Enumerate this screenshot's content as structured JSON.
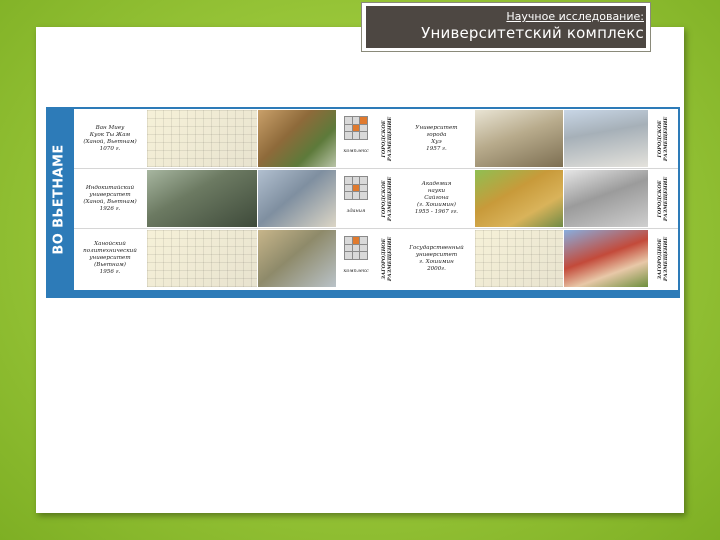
{
  "header": {
    "line1": "Научное исследование:",
    "line2": "Университетский комплекс"
  },
  "panel": {
    "vertical_label": "ВО ВЬЕТНАМЕ",
    "rows": [
      {
        "caption_left": "Ван Миеу\nКуок Ты Жам\n(Ханой, Вьетнам)\n1070 г.",
        "icon_caption_1": "комплекс",
        "rotated_1": "ГОРОДСКОЕ\nРАЗМЕЩЕНИЕ",
        "caption_right": "Университет\nгорода\nХуэ\n1957 г.",
        "icon_caption_2": "комплекс",
        "rotated_2": "ГОРОДСКОЕ\nРАЗМЕЩЕНИЕ"
      },
      {
        "caption_left": "Индокитайский\nуниверситет\n(Ханой, Вьетнам)\n1926 г.",
        "icon_caption_1": "здания",
        "rotated_1": "ГОРОДСКОЕ\nРАЗМЕЩЕНИЕ",
        "caption_right": "Академия\nнауки\nСайгона\n(г. Хошимин)\n1955 - 1967 гг.",
        "icon_caption_2": "здания",
        "rotated_2": "ГОРОДСКОЕ\nРАЗМЕЩЕНИЕ"
      },
      {
        "caption_left": "Ханойский\nполитехнический\nуниверситет\n(Вьетнам)\n1956 г.",
        "icon_caption_1": "комплекс",
        "rotated_1": "ЗАГОРОДНОЕ\nРАЗМЕЩЕНИЕ",
        "caption_right": "Государственный\nуниверситет\nг. Хошимин\n2000г.",
        "icon_caption_2": "комплекс",
        "rotated_2": "ЗАГОРОДНОЕ\nРАЗМЕЩЕНИЕ"
      }
    ]
  },
  "colors": {
    "background": "#9cc93c",
    "title_box": "#4d4742",
    "panel_frame": "#2d7bb8",
    "highlight": "#e07a2e"
  }
}
